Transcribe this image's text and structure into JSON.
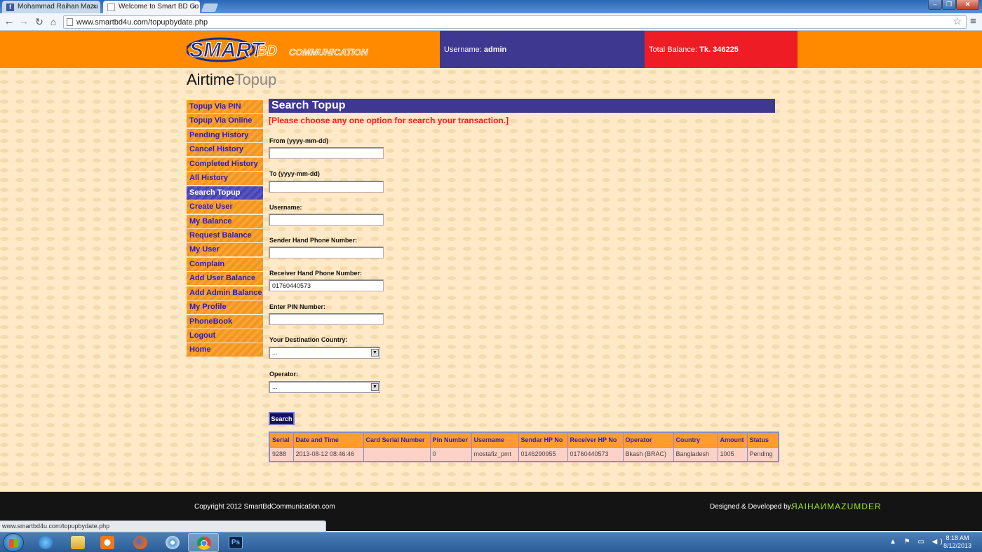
{
  "browser": {
    "tabs": [
      {
        "title": "Mohammad Raihan Mazu",
        "icon": "facebook-icon"
      },
      {
        "title": "Welcome to Smart BD Co",
        "icon": "page-icon"
      }
    ],
    "url": "www.smartbd4u.com/topupbydate.php",
    "status_url": "www.smartbd4u.com/topupbydate.php"
  },
  "header": {
    "logo_text": "SMART BD COMMUNICATION",
    "username_label": "Username:",
    "username": "admin",
    "balance_label": "Total Balance:",
    "balance": "Tk. 346225"
  },
  "page": {
    "title_dark": "Airtime",
    "title_light": "Topup"
  },
  "sidebar": {
    "items": [
      {
        "label": "Topup Via PIN"
      },
      {
        "label": "Topup Via Online"
      },
      {
        "label": "Pending History"
      },
      {
        "label": "Cancel History"
      },
      {
        "label": "Completed History"
      },
      {
        "label": "All History"
      },
      {
        "label": "Search Topup",
        "active": true
      },
      {
        "label": "Create User"
      },
      {
        "label": "My Balance"
      },
      {
        "label": "Request Balance"
      },
      {
        "label": "My User"
      },
      {
        "label": "Complain"
      },
      {
        "label": "Add User Balance"
      },
      {
        "label": "Add Admin Balance"
      },
      {
        "label": "My Profile"
      },
      {
        "label": "PhoneBook"
      },
      {
        "label": "Logout"
      },
      {
        "label": "Home"
      }
    ]
  },
  "form": {
    "section_title": "Search Topup",
    "hint": "[Please choose any one option for search your transaction.]",
    "from_label": "From (yyyy-mm-dd)",
    "from_value": "",
    "to_label": "To (yyyy-mm-dd)",
    "to_value": "",
    "username_label": "Username:",
    "username_value": "",
    "sender_label": "Sender Hand Phone Number:",
    "sender_value": "",
    "receiver_label": "Receiver Hand Phone Number:",
    "receiver_value": "01760440573",
    "pin_label": "Enter PIN Number:",
    "pin_value": "",
    "country_label": "Your Destination Country:",
    "country_selected": "...",
    "operator_label": "Operator:",
    "operator_selected": "...",
    "search_label": "Search"
  },
  "results": {
    "columns": [
      "Serial",
      "Date and Time",
      "Card Serial Number",
      "Pin Number",
      "Username",
      "Sendar HP No",
      "Receiver HP No",
      "Operator",
      "Country",
      "Amount",
      "Status"
    ],
    "rows": [
      [
        "9288",
        "2013-08-12 08:46:46",
        "",
        "0",
        "mostafiz_pmt",
        "0146290955",
        "01760440573",
        "Bkash (BRAC)",
        "Bangladesh",
        "1005",
        "Pending"
      ]
    ]
  },
  "footer": {
    "copyright": "Copyright 2012 SmartBdCommunication.com",
    "designed_by": "Designed & Developed by.",
    "designer": "ЯAIHAИMAZUMDER"
  },
  "taskbar": {
    "apps": [
      "internet-explorer-icon",
      "file-explorer-icon",
      "media-player-icon",
      "firefox-icon",
      "safari-icon",
      "chrome-icon",
      "photoshop-icon"
    ],
    "time": "8:18 AM",
    "date": "8/12/2013"
  },
  "colors": {
    "header_orange": "#ff8a00",
    "panel_purple": "#3f3891",
    "panel_red": "#ee1c24",
    "link_blue": "#2b1dc2",
    "hint_red": "#ff1a1a"
  }
}
